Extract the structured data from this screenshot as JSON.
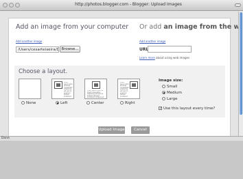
{
  "window": {
    "title": "http://photos.blogger.com - Blogger: Upload Images"
  },
  "upload": {
    "computer_heading": "Add an image from your computer",
    "web_heading_prefix": "Or add",
    "web_heading_bold": "an image from the web",
    "add_another_left": "Add another image",
    "add_another_right": "Add another image",
    "file_path": "/Users/cesarteixeira/Docu",
    "browse_label": "Browse...",
    "url_label": "URL",
    "url_value": "",
    "learn_more_link": "Learn more",
    "learn_more_text": "about using web images"
  },
  "layout": {
    "heading": "Choose a layout.",
    "options": [
      {
        "label": "None",
        "selected": false
      },
      {
        "label": "Left",
        "selected": true
      },
      {
        "label": "Center",
        "selected": false
      },
      {
        "label": "Right",
        "selected": false
      }
    ],
    "sample_text": "lorem ipsum dolor sit amet consectetur adipiscing elit sed do eiusmod tempor incididunt ut labore et dolore magna"
  },
  "image_size": {
    "heading": "Image size:",
    "options": [
      {
        "label": "Small",
        "selected": false
      },
      {
        "label": "Medium",
        "selected": true
      },
      {
        "label": "Large",
        "selected": false
      }
    ],
    "remember_label": "Use this layout every time?",
    "remember_checked": true
  },
  "buttons": {
    "upload": "Upload Image",
    "cancel": "Cancel"
  },
  "status": {
    "text": "Done"
  }
}
